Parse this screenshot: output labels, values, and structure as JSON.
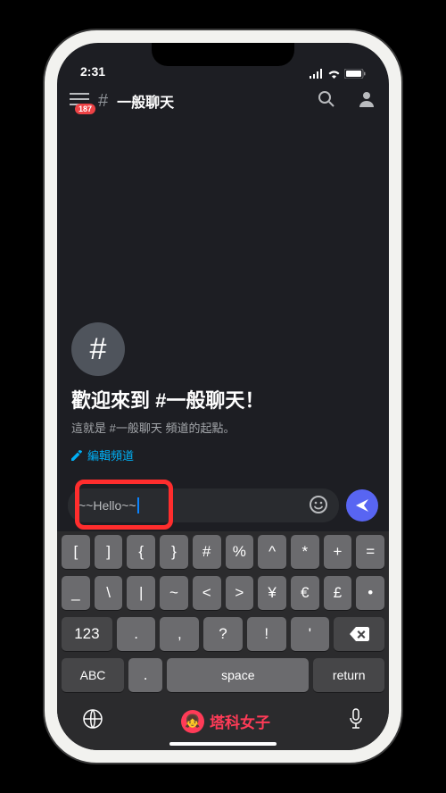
{
  "status": {
    "time": "2:31"
  },
  "header": {
    "badge": "187",
    "hash": "#",
    "channel_name": "一般聊天"
  },
  "welcome": {
    "hash": "#",
    "title": "歡迎來到 #一般聊天！",
    "subtitle": "這就是 #一般聊天 頻道的起點。",
    "edit_label": "編輯頻道"
  },
  "composer": {
    "text": "~~Hello~~"
  },
  "keyboard": {
    "row1": [
      "[",
      "]",
      "{",
      "}",
      "#",
      "%",
      "^",
      "*",
      "+",
      "="
    ],
    "row2": [
      "_",
      "\\",
      "|",
      "~",
      "<",
      ">",
      "¥",
      "€",
      "£",
      "•"
    ],
    "row3": [
      ".",
      ",",
      "?",
      "!",
      "'"
    ],
    "row4": {
      "abc": "123",
      "dot": ".",
      "space": "space",
      "ret": "return"
    },
    "bottom": {
      "abc": "ABC"
    }
  },
  "watermark": {
    "text": "塔科女子"
  }
}
